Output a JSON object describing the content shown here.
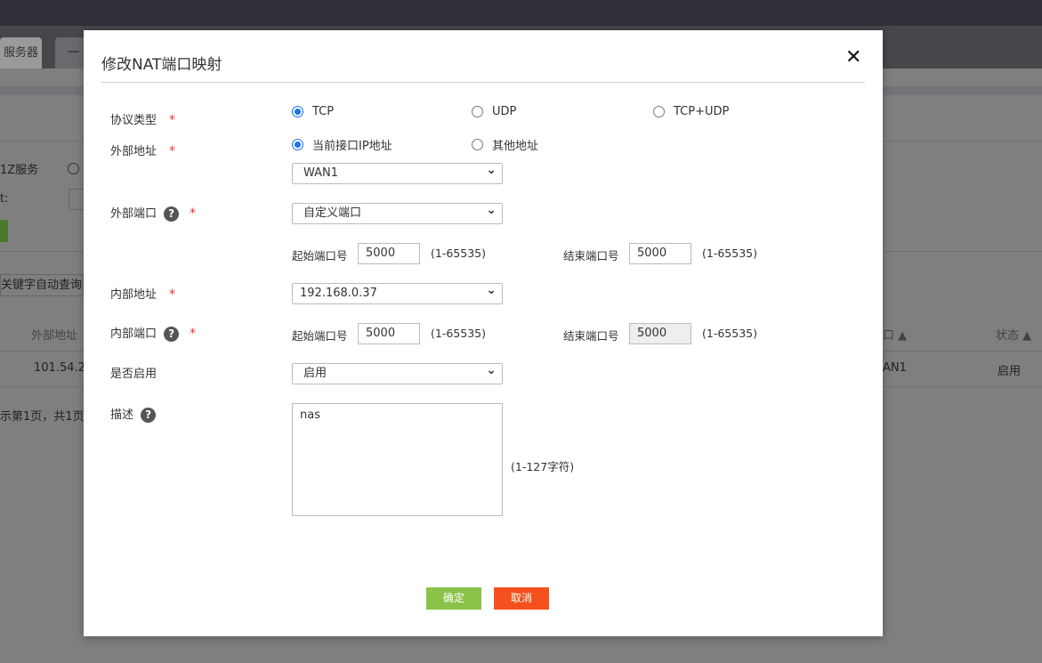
{
  "background": {
    "tabs": [
      "服务器",
      "一"
    ],
    "dmz_label": "1Z服务",
    "colon_label": "t:",
    "search_placeholder": "关键字自动查询",
    "table": {
      "headers": [
        "外部地址",
        "口",
        "状态"
      ],
      "row": [
        "101.54.2",
        "AN1",
        "启用"
      ]
    },
    "pagination": "示第1页，共1页"
  },
  "dialog": {
    "title": "修改NAT端口映射",
    "close_icon": "close-icon",
    "protocol": {
      "label": "协议类型",
      "options": [
        "TCP",
        "UDP",
        "TCP+UDP"
      ],
      "selected": "TCP"
    },
    "external_address": {
      "label": "外部地址",
      "options": [
        "当前接口IP地址",
        "其他地址"
      ],
      "selected": "当前接口IP地址",
      "interface": "WAN1"
    },
    "external_port": {
      "label": "外部端口",
      "mode": "自定义端口",
      "start_label": "起始端口号",
      "start": "5000",
      "end_label": "结束端口号",
      "end": "5000",
      "range": "(1-65535)"
    },
    "internal_address": {
      "label": "内部地址",
      "value": "192.168.0.37"
    },
    "internal_port": {
      "label": "内部端口",
      "start_label": "起始端口号",
      "start": "5000",
      "end_label": "结束端口号",
      "end": "5000",
      "range": "(1-65535)"
    },
    "enabled": {
      "label": "是否启用",
      "value": "启用"
    },
    "description": {
      "label": "描述",
      "value": "nas",
      "hint": "(1-127字符)"
    },
    "required_mark": "*",
    "help_mark": "?",
    "ok_label": "确定",
    "cancel_label": "取消",
    "colors": {
      "ok": "#8bc34a",
      "cancel": "#f4511e",
      "radio": "#1a73e8"
    }
  }
}
